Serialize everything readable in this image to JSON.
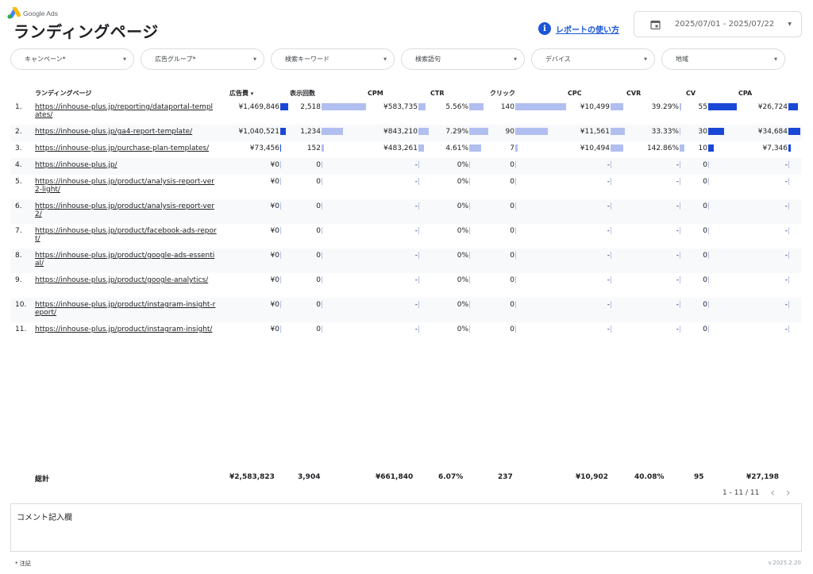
{
  "brand": {
    "logo_text": "Google Ads"
  },
  "header": {
    "title": "ランディングページ",
    "help_link": "レポートの使い方",
    "date_range": "2025/07/01 - 2025/07/22"
  },
  "filters": [
    "キャンペーン*",
    "広告グループ*",
    "検索キーワード",
    "検索語句",
    "デバイス",
    "地域"
  ],
  "table": {
    "headers": {
      "lp": "ランディングページ",
      "cost": "広告費",
      "impressions": "表示回数",
      "cpm": "CPM",
      "ctr": "CTR",
      "clicks": "クリック",
      "cpc": "CPC",
      "cvr": "CVR",
      "cv": "CV",
      "cpa": "CPA"
    },
    "sort_indicator": "▾",
    "rows": [
      {
        "idx": "1.",
        "lp": "https://inhouse-plus.jp/reporting/dataportal-templates/",
        "cost": "¥1,469,846",
        "impressions": "2,518",
        "cpm": "¥583,735",
        "ctr": "5.56%",
        "clicks": "140",
        "cpc": "¥10,499",
        "cvr": "39.29%",
        "cv": "55",
        "cpa": "¥26,724"
      },
      {
        "idx": "2.",
        "lp": "https://inhouse-plus.jp/ga4-report-template/",
        "cost": "¥1,040,521",
        "impressions": "1,234",
        "cpm": "¥843,210",
        "ctr": "7.29%",
        "clicks": "90",
        "cpc": "¥11,561",
        "cvr": "33.33%",
        "cv": "30",
        "cpa": "¥34,684"
      },
      {
        "idx": "3.",
        "lp": "https://inhouse-plus.jp/purchase-plan-templates/",
        "cost": "¥73,456",
        "impressions": "152",
        "cpm": "¥483,261",
        "ctr": "4.61%",
        "clicks": "7",
        "cpc": "¥10,494",
        "cvr": "142.86%",
        "cv": "10",
        "cpa": "¥7,346"
      },
      {
        "idx": "4.",
        "lp": "https://inhouse-plus.jp/",
        "cost": "¥0",
        "impressions": "0",
        "cpm": "-",
        "ctr": "0%",
        "clicks": "0",
        "cpc": "-",
        "cvr": "-",
        "cv": "0",
        "cpa": "-"
      },
      {
        "idx": "5.",
        "lp": "https://inhouse-plus.jp/product/analysis-report-ver2-light/",
        "cost": "¥0",
        "impressions": "0",
        "cpm": "-",
        "ctr": "0%",
        "clicks": "0",
        "cpc": "-",
        "cvr": "-",
        "cv": "0",
        "cpa": "-"
      },
      {
        "idx": "6.",
        "lp": "https://inhouse-plus.jp/product/analysis-report-ver2/",
        "cost": "¥0",
        "impressions": "0",
        "cpm": "-",
        "ctr": "0%",
        "clicks": "0",
        "cpc": "-",
        "cvr": "-",
        "cv": "0",
        "cpa": "-"
      },
      {
        "idx": "7.",
        "lp": "https://inhouse-plus.jp/product/facebook-ads-report/",
        "cost": "¥0",
        "impressions": "0",
        "cpm": "-",
        "ctr": "0%",
        "clicks": "0",
        "cpc": "-",
        "cvr": "-",
        "cv": "0",
        "cpa": "-"
      },
      {
        "idx": "8.",
        "lp": "https://inhouse-plus.jp/product/google-ads-essential/",
        "cost": "¥0",
        "impressions": "0",
        "cpm": "-",
        "ctr": "0%",
        "clicks": "0",
        "cpc": "-",
        "cvr": "-",
        "cv": "0",
        "cpa": "-"
      },
      {
        "idx": "9.",
        "lp": "https://inhouse-plus.jp/product/google-analytics/",
        "cost": "¥0",
        "impressions": "0",
        "cpm": "-",
        "ctr": "0%",
        "clicks": "0",
        "cpc": "-",
        "cvr": "-",
        "cv": "0",
        "cpa": "-"
      },
      {
        "idx": "10.",
        "lp": "https://inhouse-plus.jp/product/instagram-insight-report/",
        "cost": "¥0",
        "impressions": "0",
        "cpm": "-",
        "ctr": "0%",
        "clicks": "0",
        "cpc": "-",
        "cvr": "-",
        "cv": "0",
        "cpa": "-"
      },
      {
        "idx": "11.",
        "lp": "https://inhouse-plus.jp/product/instagram-insight/",
        "cost": "¥0",
        "impressions": "0",
        "cpm": "-",
        "ctr": "0%",
        "clicks": "0",
        "cpc": "-",
        "cvr": "-",
        "cv": "0",
        "cpa": "-"
      }
    ],
    "totals": {
      "label": "総計",
      "cost": "¥2,583,823",
      "impressions": "3,904",
      "cpm": "¥661,840",
      "ctr": "6.07%",
      "clicks": "237",
      "cpc": "¥10,902",
      "cvr": "40.08%",
      "cv": "95",
      "cpa": "¥27,198"
    },
    "pagination": "1 - 11 / 11"
  },
  "comment": {
    "label": "コメント記入欄"
  },
  "footnote": "* 注記",
  "version": "v.2025.2.20",
  "colors": {
    "accent": "#1a56d6",
    "bar_dark": "#1a48d6",
    "bar_light": "#b1bff0"
  }
}
